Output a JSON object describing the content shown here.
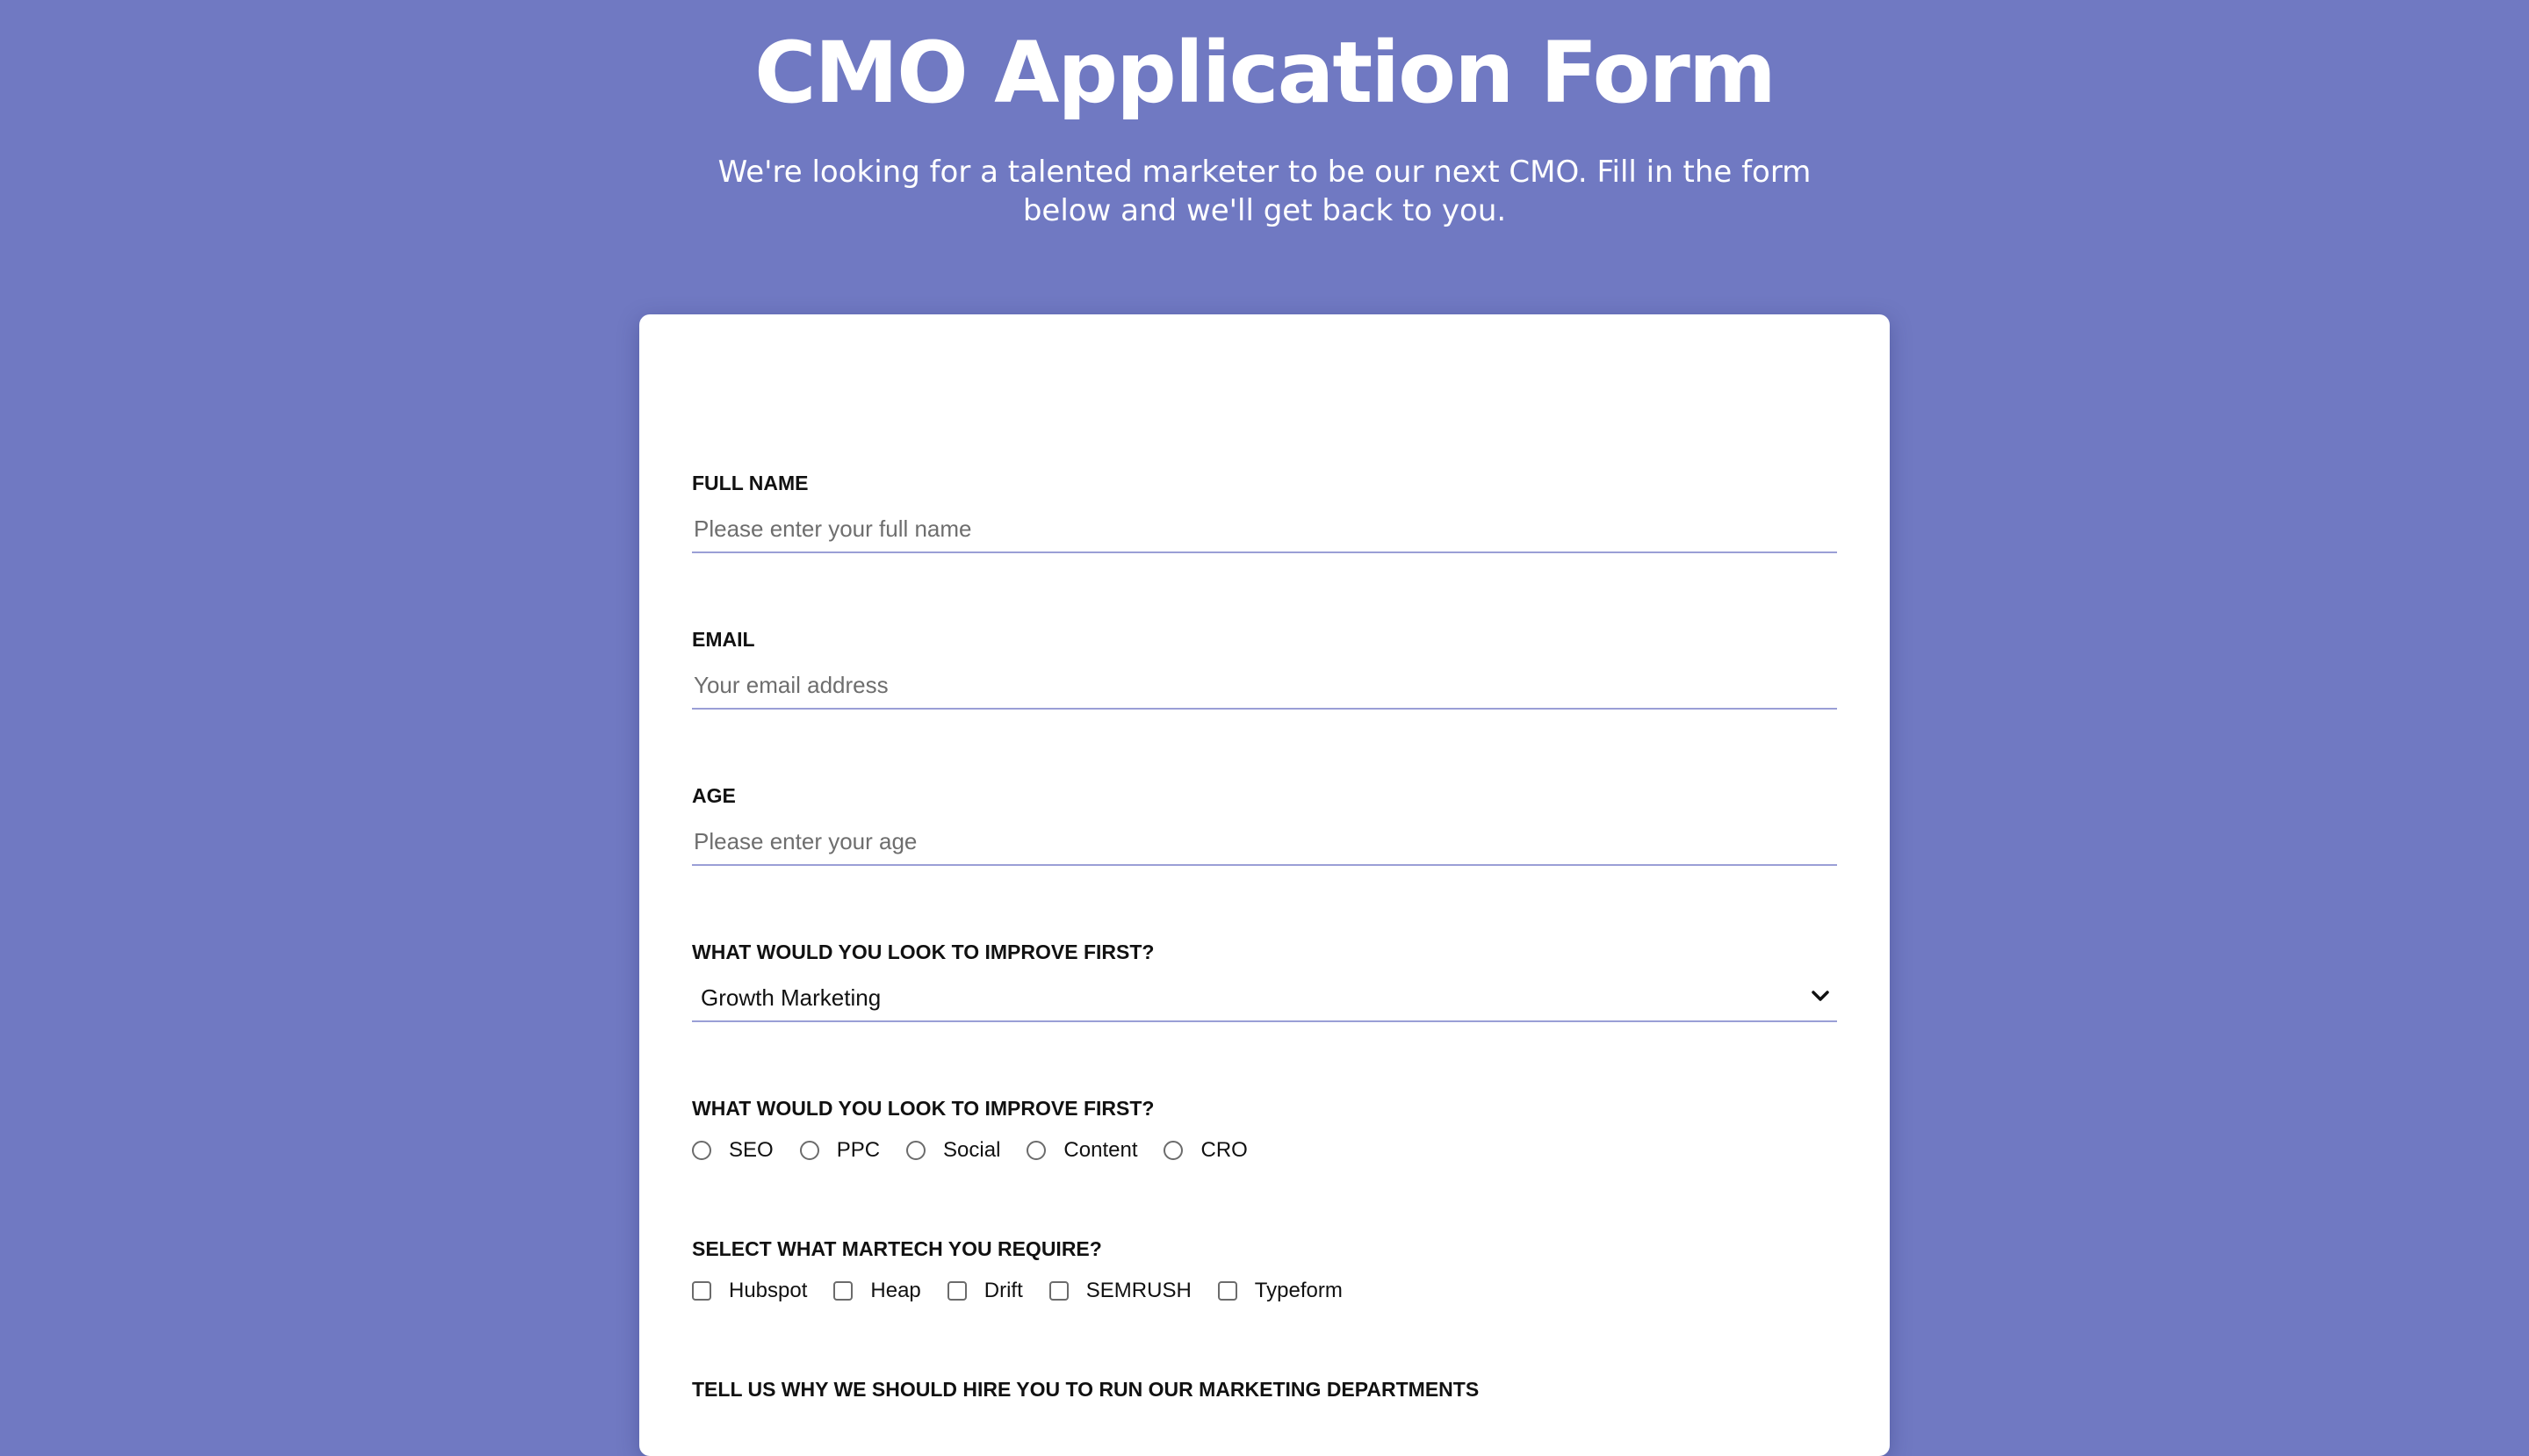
{
  "header": {
    "title": "CMO Application Form",
    "subtitle": "We're looking for a talented marketer to be our next CMO. Fill in the form below and we'll get back to you."
  },
  "form": {
    "full_name": {
      "label": "FULL NAME",
      "placeholder": "Please enter your full name",
      "value": ""
    },
    "email": {
      "label": "EMAIL",
      "placeholder": "Your email address",
      "value": ""
    },
    "age": {
      "label": "AGE",
      "placeholder": "Please enter your age",
      "value": ""
    },
    "improve_select": {
      "label": "WHAT WOULD YOU LOOK TO IMPROVE FIRST?",
      "selected": "Growth Marketing",
      "icon": "chevron-down-icon"
    },
    "improve_radio": {
      "label": "WHAT WOULD YOU LOOK TO IMPROVE FIRST?",
      "options": [
        {
          "label": "SEO",
          "checked": false
        },
        {
          "label": "PPC",
          "checked": false
        },
        {
          "label": "Social",
          "checked": false
        },
        {
          "label": "Content",
          "checked": false
        },
        {
          "label": "CRO",
          "checked": false
        }
      ]
    },
    "martech": {
      "label": "SELECT WHAT MARTECH YOU REQUIRE?",
      "options": [
        {
          "label": "Hubspot",
          "checked": false
        },
        {
          "label": "Heap",
          "checked": false
        },
        {
          "label": "Drift",
          "checked": false
        },
        {
          "label": "SEMRUSH",
          "checked": false
        },
        {
          "label": "Typeform",
          "checked": false
        }
      ]
    },
    "why_hire": {
      "label": "TELL US WHY WE SHOULD HIRE YOU TO RUN OUR MARKETING DEPARTMENTS"
    }
  },
  "colors": {
    "background": "#7079c2",
    "card": "#ffffff",
    "input_underline": "#9a9fd6",
    "title_text": "#ffffff"
  }
}
